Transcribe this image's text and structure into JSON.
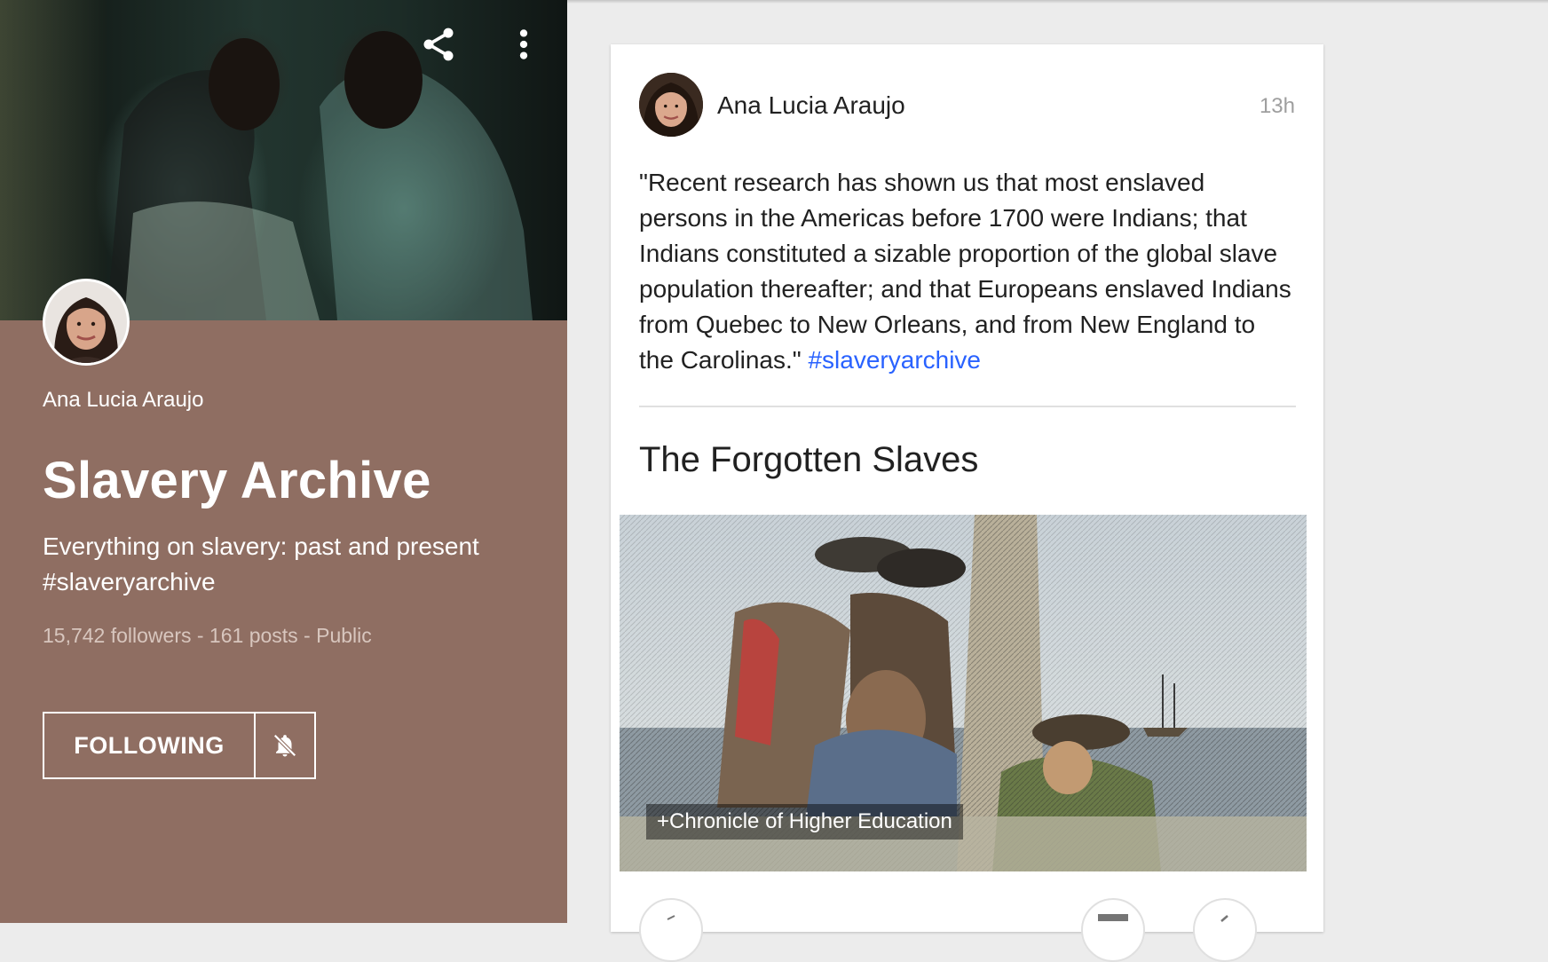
{
  "collection": {
    "owner_name": "Ana Lucia Araujo",
    "title": "Slavery Archive",
    "description": "Everything on slavery: past and present #slaveryarchive",
    "stats": "15,742 followers - 161 posts - Public",
    "following_label": "FOLLOWING",
    "panel_color": "#8f6e62"
  },
  "post": {
    "author": "Ana Lucia Araujo",
    "time": "13h",
    "text": "\"Recent research has shown us that most enslaved persons in the Americas before 1700 were Indians; that Indians constituted a sizable proportion of the global slave population thereafter; and that Europeans enslaved Indians from Quebec to New Orleans, and from New England to the Carolinas.\"",
    "hashtag": "#slaveryarchive",
    "link_title": "The Forgotten Slaves",
    "image_caption": "+Chronicle of Higher Education",
    "hashtag_color": "#2962ff"
  },
  "icons": {
    "share": "share-icon",
    "more": "more-vert-icon",
    "bell_off": "notifications-off-icon"
  }
}
